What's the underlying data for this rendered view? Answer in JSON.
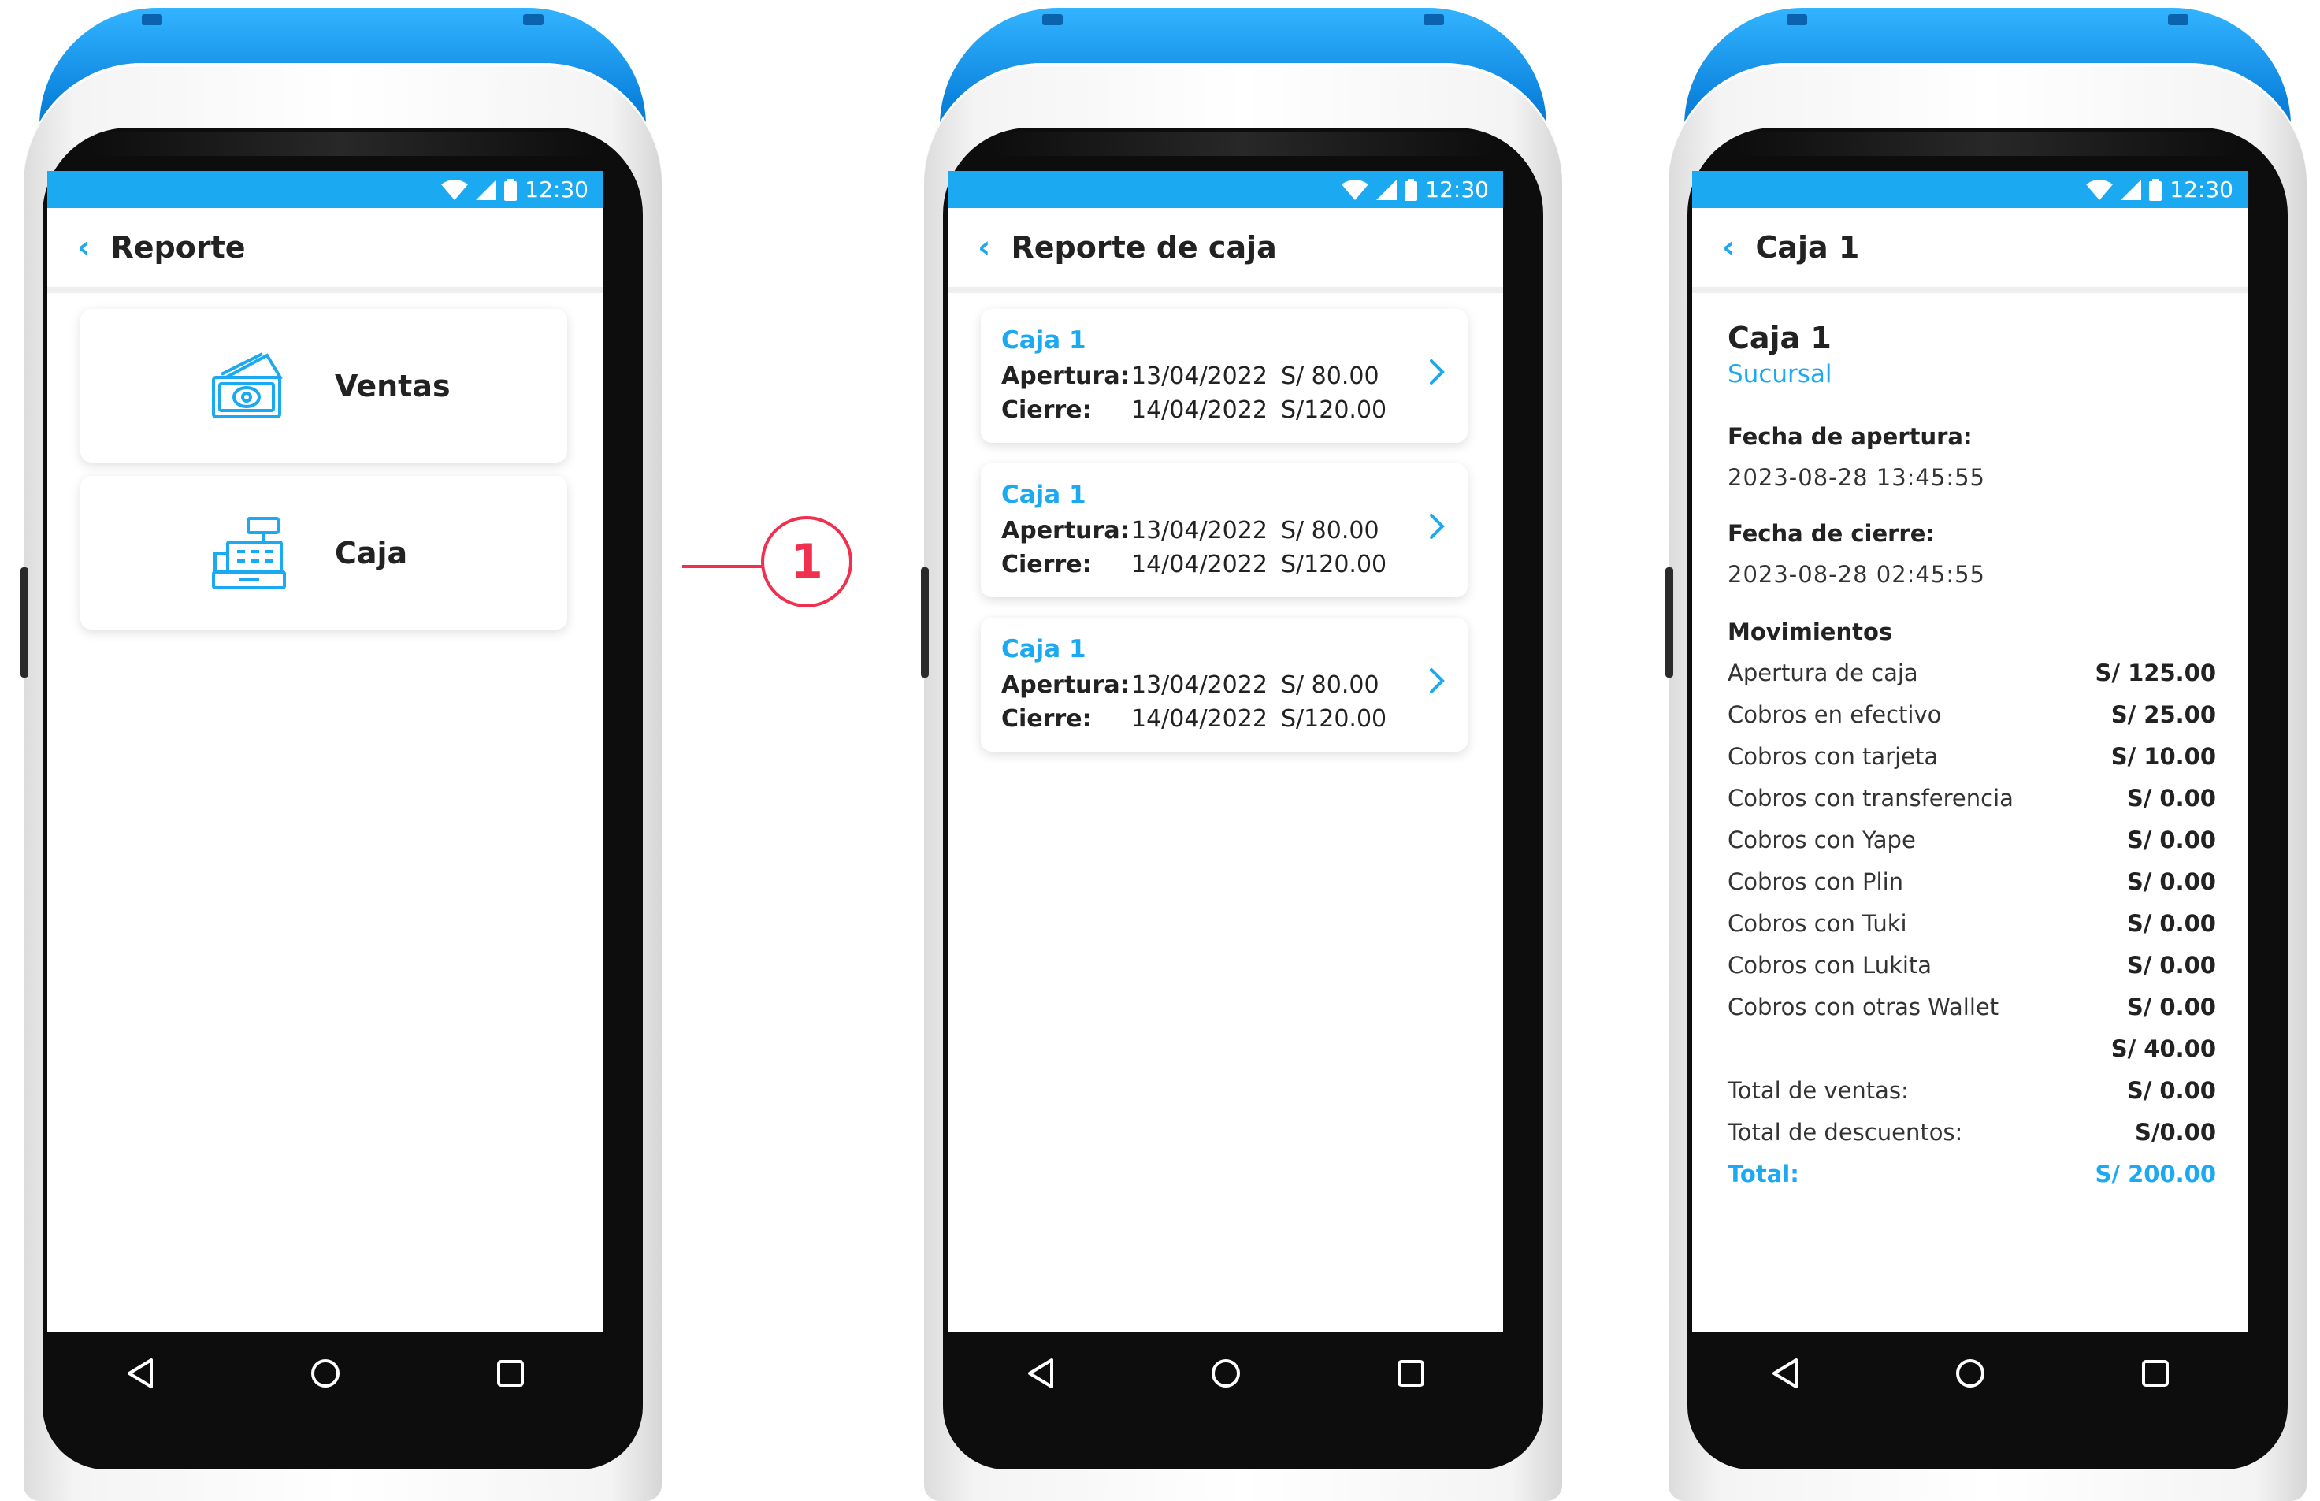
{
  "status": {
    "time": "12:30"
  },
  "screen1": {
    "title": "Reporte",
    "menu": [
      {
        "label": "Ventas",
        "icon": "money-icon"
      },
      {
        "label": "Caja",
        "icon": "cash-register-icon"
      }
    ]
  },
  "annotation": {
    "step": "1"
  },
  "screen2": {
    "title": "Reporte de caja",
    "open_label": "Apertura:",
    "close_label": "Cierre:",
    "items": [
      {
        "name": "Caja 1",
        "open_date": "13/04/2022",
        "open_amount": "S/ 80.00",
        "close_date": "14/04/2022",
        "close_amount": "S/120.00"
      },
      {
        "name": "Caja 1",
        "open_date": "13/04/2022",
        "open_amount": "S/ 80.00",
        "close_date": "14/04/2022",
        "close_amount": "S/120.00"
      },
      {
        "name": "Caja 1",
        "open_date": "13/04/2022",
        "open_amount": "S/ 80.00",
        "close_date": "14/04/2022",
        "close_amount": "S/120.00"
      }
    ]
  },
  "screen3": {
    "title": "Caja 1",
    "heading": "Caja 1",
    "branch": "Sucursal",
    "open_label": "Fecha de apertura:",
    "open_value": "2023-08-28  13:45:55",
    "close_label": "Fecha de cierre:",
    "close_value": "2023-08-28  02:45:55",
    "movements_label": "Movimientos",
    "movements": [
      {
        "label": "Apertura de caja",
        "amount": "S/ 125.00"
      },
      {
        "label": "Cobros en efectivo",
        "amount": "S/ 25.00"
      },
      {
        "label": "Cobros con tarjeta",
        "amount": "S/ 10.00"
      },
      {
        "label": "Cobros con transferencia",
        "amount": "S/ 0.00"
      },
      {
        "label": "Cobros con Yape",
        "amount": "S/ 0.00"
      },
      {
        "label": "Cobros con Plin",
        "amount": "S/ 0.00"
      },
      {
        "label": "Cobros con Tuki",
        "amount": "S/ 0.00"
      },
      {
        "label": "Cobros con Lukita",
        "amount": "S/ 0.00"
      },
      {
        "label": "Cobros con otras Wallet",
        "amount": "S/ 0.00"
      },
      {
        "label": "",
        "amount": "S/ 40.00"
      },
      {
        "label": "Total de ventas:",
        "amount": "S/ 0.00"
      },
      {
        "label": "Total de descuentos:",
        "amount": "S/0.00"
      },
      {
        "label": "Total:",
        "amount": "S/ 200.00"
      }
    ]
  },
  "colors": {
    "accent": "#1ba9f1",
    "annotation": "#f0304e",
    "device_top": "#0a82dd"
  }
}
